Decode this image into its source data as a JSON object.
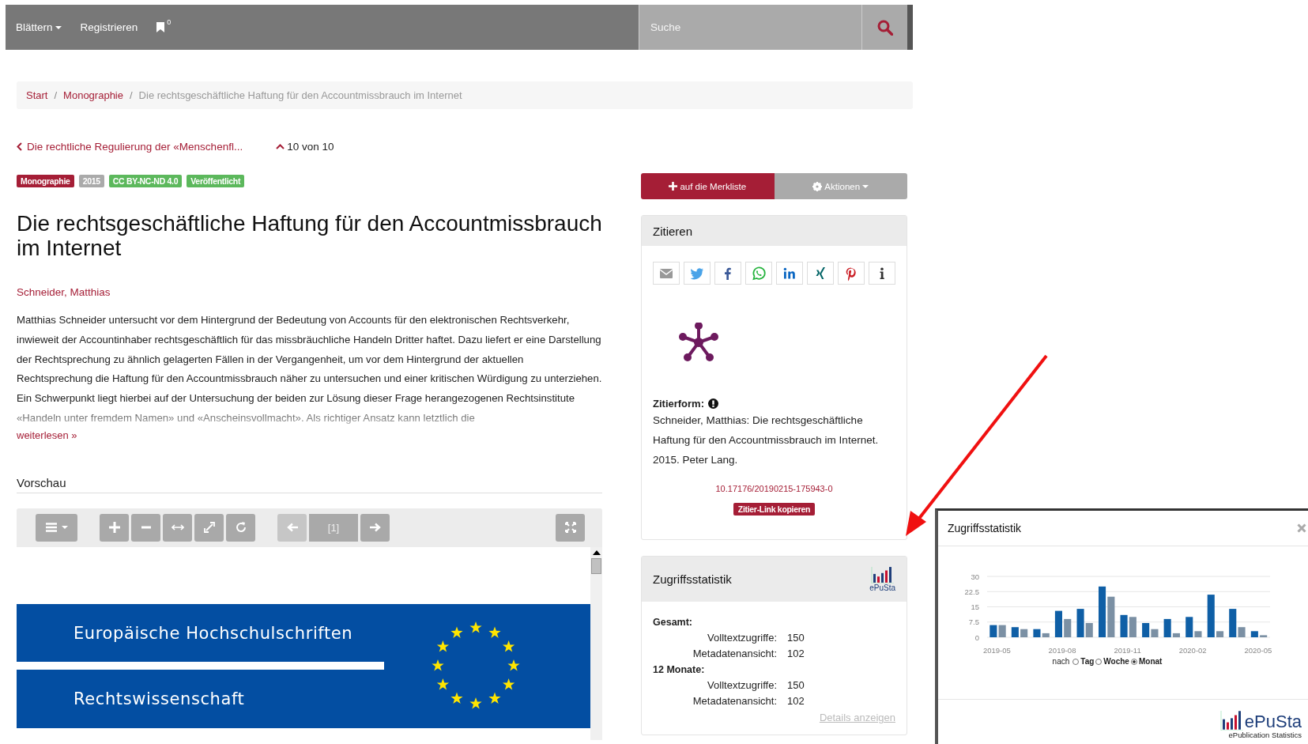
{
  "navbar": {
    "menu": "Blättern",
    "register": "Registrieren",
    "bookmark_count": "0",
    "search": {
      "placeholder": "Suche"
    }
  },
  "breadcrumb": [
    {
      "label": "Start",
      "link": true
    },
    {
      "separator": "/",
      "label": "Monographie",
      "link": true
    },
    {
      "separator": "/",
      "label": "Die rechtsgeschäftliche Haftung für den Accountmissbrauch im Internet",
      "link": false
    }
  ],
  "prev_link": "Die rechtliche Regulierung der «Menschenfl...",
  "position": "10 von 10",
  "badges": [
    {
      "label": "Monographie",
      "color": "#a51e36"
    },
    {
      "label": "2015",
      "color": "#aaaaaa"
    },
    {
      "label": "CC BY-NC-ND 4.0",
      "color": "#5cb85c"
    },
    {
      "label": "Veröffentlicht",
      "color": "#5cb85c"
    }
  ],
  "title": "Die rechtsgeschäftliche Haftung für den Accountmissbrauch im Internet",
  "author": "Schneider, Matthias",
  "abstract": "Matthias Schneider untersucht vor dem Hintergrund der Bedeutung von Accounts für den elektronischen Rechtsverkehr, inwieweit der Accountinhaber rechtsgeschäftlich für das missbräuchliche Handeln Dritter haftet. Dazu liefert er eine Darstellung der Rechtsprechung zu ähnlich gelagerten Fällen in der Vergangenheit, um vor dem Hintergrund der aktuellen Rechtsprechung die Haftung für den Accountmissbrauch näher zu untersuchen und einer kritischen Würdigung zu unterziehen. Ein Schwerpunkt liegt hierbei auf der Untersuchung der beiden zur Lösung dieser Frage herangezogenen Rechtsinstitute «Handeln unter fremdem Namen» und «Anscheinsvollmacht». Als richtiger Ansatz kann letztlich die",
  "read_more": "weiterlesen »",
  "preview": {
    "heading": "Vorschau",
    "page_field": "[1]",
    "previous_disabled": true,
    "next_disabled": false,
    "document": {
      "series": "Europäische Hochschulschriften",
      "subject": "Rechtswissenschaft"
    }
  },
  "actions": {
    "bookmark": "auf die Merkliste",
    "more": "Aktionen"
  },
  "cite": {
    "heading": "Zitieren",
    "label": "Zitierform:",
    "citation": "Schneider, Matthias: Die rechtsgeschäftliche Haftung für den Accountmissbrauch im Internet. 2015. Peter Lang.",
    "doi": "10.17176/20190215-175943-0",
    "copy_button": "Zitier-Link kopieren"
  },
  "stats": {
    "heading": "Zugriffsstatistik",
    "logo": "ePuSta",
    "groups": [
      {
        "label": "Gesamt:",
        "rows": [
          {
            "label": "Volltextzugriffe:",
            "value": "150"
          },
          {
            "label": "Metadatenansicht:",
            "value": "102"
          }
        ]
      },
      {
        "label": "12 Monate:",
        "rows": [
          {
            "label": "Volltextzugriffe:",
            "value": "150"
          },
          {
            "label": "Metadatenansicht:",
            "value": "102"
          }
        ]
      }
    ],
    "details_link": "Details anzeigen"
  },
  "popup": {
    "title": "Zugriffsstatistik",
    "chart_data": {
      "type": "bar",
      "ylim": [
        0,
        30
      ],
      "yticks": [
        0,
        7.5,
        15,
        22.5,
        30
      ],
      "grid": true,
      "categories": [
        "2019-05",
        null,
        null,
        "2019-08",
        null,
        null,
        "2019-11",
        null,
        null,
        "2020-02",
        null,
        null,
        "2020-05"
      ],
      "series": [
        {
          "color": "#0f5fa6",
          "values": [
            6,
            5,
            4,
            13,
            14,
            25,
            11,
            7,
            9,
            10,
            21,
            14,
            3
          ]
        },
        {
          "color": "#7b90a4",
          "values": [
            6,
            4,
            2,
            9,
            7,
            20,
            10,
            4,
            2,
            3,
            3,
            5,
            1
          ]
        }
      ]
    },
    "period_label": "nach",
    "periods": [
      {
        "label": "Tag",
        "selected": false
      },
      {
        "label": "Woche",
        "selected": false
      },
      {
        "label": "Monat",
        "selected": true
      }
    ],
    "logo": "ePuSta",
    "logo_subtitle": "ePublication Statistics"
  }
}
